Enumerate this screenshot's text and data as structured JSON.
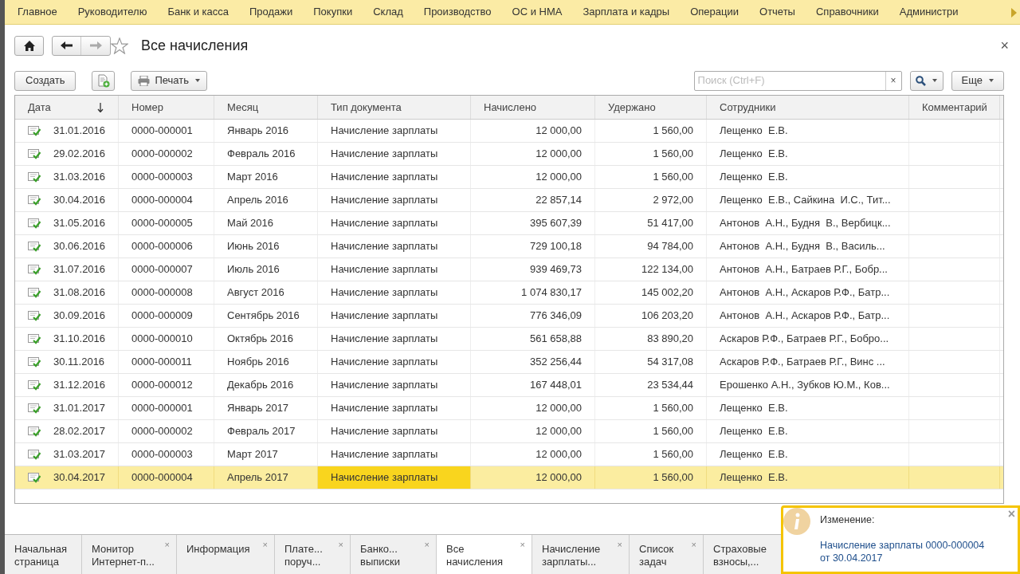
{
  "menu": [
    {
      "label": "Главное"
    },
    {
      "label": "Руководителю"
    },
    {
      "label": "Банк и касса"
    },
    {
      "label": "Продажи"
    },
    {
      "label": "Покупки"
    },
    {
      "label": "Склад"
    },
    {
      "label": "Производство"
    },
    {
      "label": "ОС и НМА"
    },
    {
      "label": "Зарплата и кадры"
    },
    {
      "label": "Операции"
    },
    {
      "label": "Отчеты"
    },
    {
      "label": "Справочники"
    },
    {
      "label": "Администри"
    }
  ],
  "form": {
    "title": "Все начисления",
    "close": "×"
  },
  "toolbar": {
    "create": "Создать",
    "print": "Печать",
    "search": {
      "placeholder": "Поиск (Ctrl+F)",
      "clear": "×"
    },
    "more": "Еще"
  },
  "table": {
    "columns": [
      "Дата",
      "Номер",
      "Месяц",
      "Тип документа",
      "Начислено",
      "Удержано",
      "Сотрудники",
      "Комментарий"
    ],
    "rows": [
      {
        "date": "31.01.2016",
        "number": "0000-000001",
        "month": "Январь 2016",
        "type": "Начисление зарплаты",
        "accrued": "12 000,00",
        "withheld": "1 560,00",
        "employees": "Лещенко  Е.В.",
        "selected": false
      },
      {
        "date": "29.02.2016",
        "number": "0000-000002",
        "month": "Февраль 2016",
        "type": "Начисление зарплаты",
        "accrued": "12 000,00",
        "withheld": "1 560,00",
        "employees": "Лещенко  Е.В.",
        "selected": false
      },
      {
        "date": "31.03.2016",
        "number": "0000-000003",
        "month": "Март 2016",
        "type": "Начисление зарплаты",
        "accrued": "12 000,00",
        "withheld": "1 560,00",
        "employees": "Лещенко  Е.В.",
        "selected": false
      },
      {
        "date": "30.04.2016",
        "number": "0000-000004",
        "month": "Апрель 2016",
        "type": "Начисление зарплаты",
        "accrued": "22 857,14",
        "withheld": "2 972,00",
        "employees": "Лещенко  Е.В., Сайкина  И.С., Тит...",
        "selected": false
      },
      {
        "date": "31.05.2016",
        "number": "0000-000005",
        "month": "Май 2016",
        "type": "Начисление зарплаты",
        "accrued": "395 607,39",
        "withheld": "51 417,00",
        "employees": "Антонов  А.Н., Будня  В., Вербицк...",
        "selected": false
      },
      {
        "date": "30.06.2016",
        "number": "0000-000006",
        "month": "Июнь 2016",
        "type": "Начисление зарплаты",
        "accrued": "729 100,18",
        "withheld": "94 784,00",
        "employees": "Антонов  А.Н., Будня  В., Василь...",
        "selected": false
      },
      {
        "date": "31.07.2016",
        "number": "0000-000007",
        "month": "Июль 2016",
        "type": "Начисление зарплаты",
        "accrued": "939 469,73",
        "withheld": "122 134,00",
        "employees": "Антонов  А.Н., Батраев Р.Г., Бобр...",
        "selected": false
      },
      {
        "date": "31.08.2016",
        "number": "0000-000008",
        "month": "Август 2016",
        "type": "Начисление зарплаты",
        "accrued": "1 074 830,17",
        "withheld": "145 002,20",
        "employees": "Антонов  А.Н., Аскаров Р.Ф., Батр...",
        "selected": false
      },
      {
        "date": "30.09.2016",
        "number": "0000-000009",
        "month": "Сентябрь 2016",
        "type": "Начисление зарплаты",
        "accrued": "776 346,09",
        "withheld": "106 203,20",
        "employees": "Антонов  А.Н., Аскаров Р.Ф., Батр...",
        "selected": false
      },
      {
        "date": "31.10.2016",
        "number": "0000-000010",
        "month": "Октябрь 2016",
        "type": "Начисление зарплаты",
        "accrued": "561 658,88",
        "withheld": "83 890,20",
        "employees": "Аскаров Р.Ф., Батраев Р.Г., Бобро...",
        "selected": false
      },
      {
        "date": "30.11.2016",
        "number": "0000-000011",
        "month": "Ноябрь 2016",
        "type": "Начисление зарплаты",
        "accrued": "352 256,44",
        "withheld": "54 317,08",
        "employees": "Аскаров Р.Ф., Батраев Р.Г., Винс ...",
        "selected": false
      },
      {
        "date": "31.12.2016",
        "number": "0000-000012",
        "month": "Декабрь 2016",
        "type": "Начисление зарплаты",
        "accrued": "167 448,01",
        "withheld": "23 534,44",
        "employees": "Ерошенко А.Н., Зубков Ю.М., Ков...",
        "selected": false
      },
      {
        "date": "31.01.2017",
        "number": "0000-000001",
        "month": "Январь 2017",
        "type": "Начисление зарплаты",
        "accrued": "12 000,00",
        "withheld": "1 560,00",
        "employees": "Лещенко  Е.В.",
        "selected": false
      },
      {
        "date": "28.02.2017",
        "number": "0000-000002",
        "month": "Февраль 2017",
        "type": "Начисление зарплаты",
        "accrued": "12 000,00",
        "withheld": "1 560,00",
        "employees": "Лещенко  Е.В.",
        "selected": false
      },
      {
        "date": "31.03.2017",
        "number": "0000-000003",
        "month": "Март 2017",
        "type": "Начисление зарплаты",
        "accrued": "12 000,00",
        "withheld": "1 560,00",
        "employees": "Лещенко  Е.В.",
        "selected": false
      },
      {
        "date": "30.04.2017",
        "number": "0000-000004",
        "month": "Апрель 2017",
        "type": "Начисление зарплаты",
        "accrued": "12 000,00",
        "withheld": "1 560,00",
        "employees": "Лещенко  Е.В.",
        "selected": true
      }
    ]
  },
  "tabs": [
    {
      "label": "Начальная\nстраница",
      "selected": false
    },
    {
      "label": "Монитор\nИнтернет-п...",
      "close": "×",
      "selected": false
    },
    {
      "label": "Информация",
      "close": "×",
      "selected": false
    },
    {
      "label": "Плате...\nпоруч...",
      "close": "×",
      "selected": false
    },
    {
      "label": "Банко...\nвыписки",
      "close": "×",
      "selected": false
    },
    {
      "label": "Все\nначисления",
      "close": "×",
      "selected": true
    },
    {
      "label": "Начисление\nзарплаты...",
      "close": "×",
      "selected": false
    },
    {
      "label": "Список\nзадач",
      "close": "×",
      "selected": false
    },
    {
      "label": "Страховые\nвзносы,...",
      "selected": false
    }
  ],
  "notification": {
    "title": "Изменение:",
    "link": "Начисление зарплаты 0000-000004\nот 30.04.2017",
    "close": "×"
  }
}
